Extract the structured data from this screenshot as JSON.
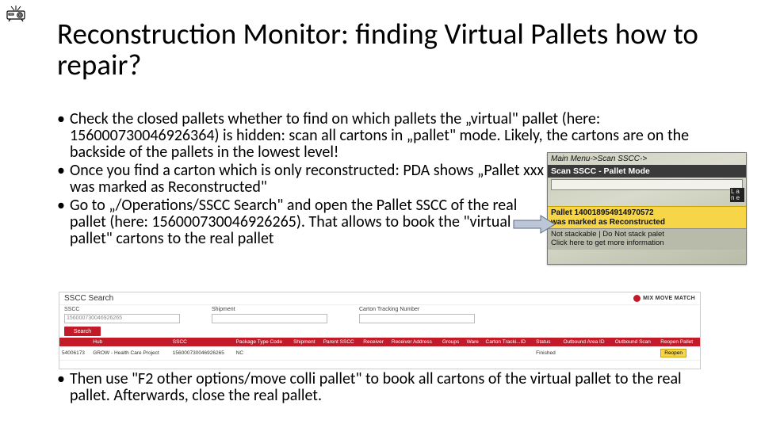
{
  "title": "Reconstruction Monitor: finding Virtual Pallets how to repair?",
  "bullets": {
    "b1": "Check the closed pallets whether to find on which pallets the „virtual\" pallet (here: 156000730046926364) is hidden: scan all cartons in „pallet\" mode. Likely, the cartons are on the backside of the pallets in the lowest level!",
    "b2": "Once you find a carton which is only reconstructed: PDA shows „Pallet xxx was marked as Reconstructed\"",
    "b3": "Go to „/Operations/SSCC Search\" and open the Pallet SSCC of the real pallet (here: 156000730046926265). That allows to book the \"virtual pallet\" cartons to the real pallet",
    "b4": "Then use \"F2 other options/move colli pallet\" to book all cartons of the virtual pallet to the real pallet. Afterwards, close the real pallet."
  },
  "pda": {
    "breadcrumb": "Main Menu->Scan SSCC->",
    "header": "Scan SSCC - Pallet Mode",
    "side": "L a n e",
    "yellow_l1": "Pallet 140018954914970572",
    "yellow_l2": "was marked as Reconstructed",
    "gray_l1": "Not stackable | Do Not stack palet",
    "gray_l2": "Click here to get more information"
  },
  "sscc": {
    "title": "SSCC Search",
    "logo": "MIX MOVE MATCH",
    "labels": {
      "sscc": "SSCC",
      "shipment": "Shipment",
      "ctn": "Carton Tracking Number"
    },
    "sscc_value": "156000730046926265",
    "search_btn": "Search",
    "headers": [
      "",
      "Hub",
      "SSCC",
      "Package Type Code",
      "Shipment",
      "Parent SSCC",
      "Receiver",
      "Receiver Address",
      "Groups",
      "Ware",
      "Carton Tracki...ID",
      "Status",
      "Outbound Area ID",
      "Outbound Scan",
      "Reopen Pallet"
    ],
    "row": {
      "hub": "54006173",
      "hubname": "GROW - Health Care Project",
      "sscc": "156000730046926265",
      "pkg": "NC",
      "status": "Finished",
      "reopen": "Reopen"
    }
  }
}
